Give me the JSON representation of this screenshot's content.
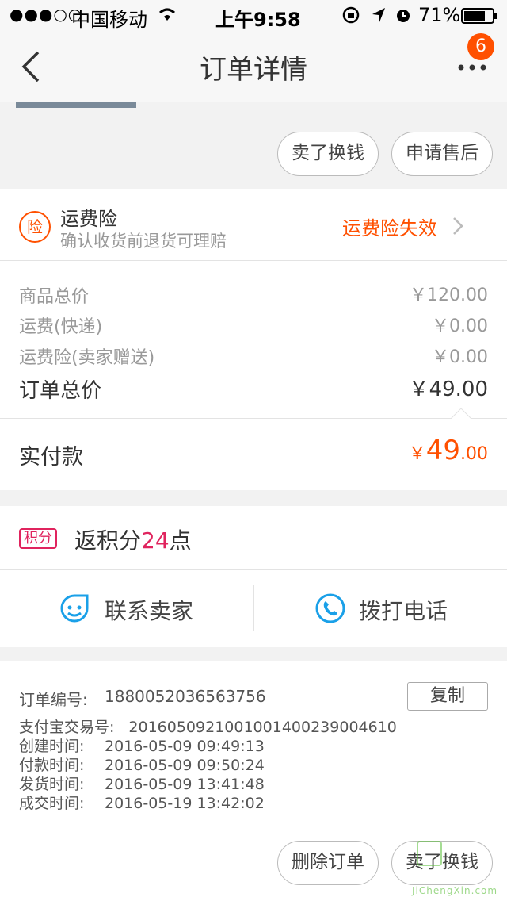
{
  "status_bar": {
    "signal": "●●●○○",
    "carrier": "中国移动",
    "time": "上午9:58",
    "battery": "71%"
  },
  "nav": {
    "title": "订单详情",
    "badge": "6"
  },
  "top_actions": {
    "sell_label": "卖了换钱",
    "after_sale_label": "申请售后"
  },
  "insurance": {
    "icon_text": "险",
    "title": "运费险",
    "subtitle": "确认收货前退货可理赔",
    "status": "运费险失效"
  },
  "price_rows": [
    {
      "label": "商品总价",
      "value": "￥120.00"
    },
    {
      "label": "运费(快递)",
      "value": "￥0.00"
    },
    {
      "label": "运费险(卖家赠送)",
      "value": "￥0.00"
    }
  ],
  "order_total": {
    "label": "订单总价",
    "value": "￥49.00"
  },
  "paid": {
    "label": "实付款",
    "currency": "￥",
    "integer": "49",
    "decimal": ".00"
  },
  "points": {
    "badge": "积分",
    "prefix": "返积分",
    "number": "24",
    "suffix": "点"
  },
  "contact": {
    "seller_label": "联系卖家",
    "call_label": "拨打电话"
  },
  "order_info": {
    "order_no_label": "订单编号:",
    "order_no": "1880052036563756",
    "copy_label": "复制",
    "lines": [
      {
        "label": "支付宝交易号:",
        "value": "2016050921001001400239004610"
      },
      {
        "label": "创建时间:",
        "value": "2016-05-09 09:49:13"
      },
      {
        "label": "付款时间:",
        "value": "2016-05-09 09:50:24"
      },
      {
        "label": "发货时间:",
        "value": "2016-05-09 13:41:48"
      },
      {
        "label": "成交时间:",
        "value": "2016-05-19 13:42:02"
      }
    ]
  },
  "bottom_actions": {
    "delete_label": "删除订单",
    "sell_label": "卖了换钱"
  },
  "watermark": {
    "text": "JiChengXin.com"
  },
  "colors": {
    "accent_orange": "#ff5000",
    "points_red": "#e0245e",
    "contact_blue": "#1aa0e8"
  }
}
